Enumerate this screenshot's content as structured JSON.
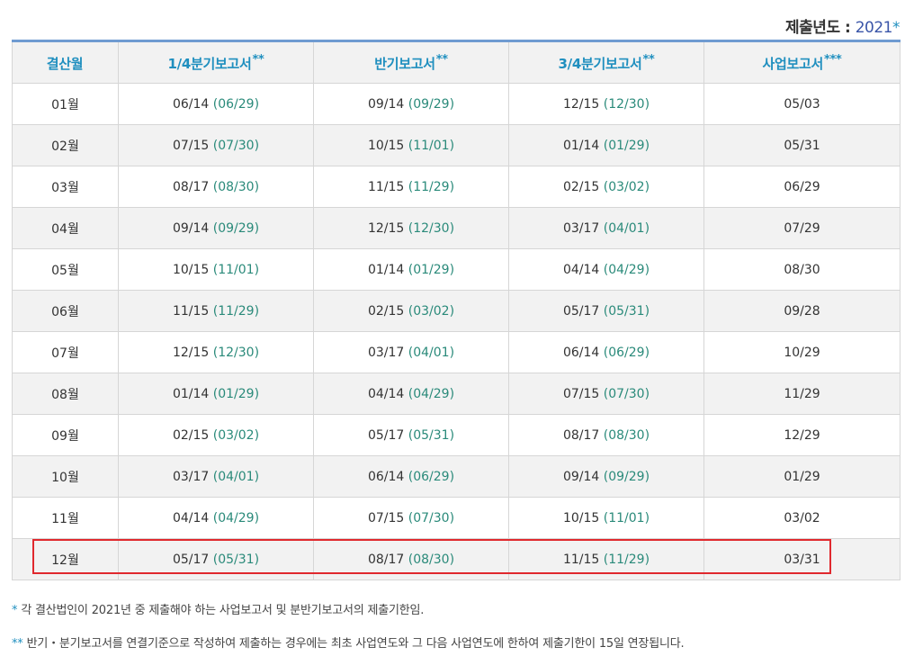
{
  "year_line": {
    "label": "제출년도 : ",
    "year": "2021",
    "star": "*"
  },
  "table": {
    "headers": [
      {
        "label": "결산월",
        "stars": ""
      },
      {
        "label": "1/4분기보고서",
        "stars": "**"
      },
      {
        "label": "반기보고서",
        "stars": "**"
      },
      {
        "label": "3/4분기보고서",
        "stars": "**"
      },
      {
        "label": "사업보고서",
        "stars": "***"
      }
    ],
    "rows": [
      {
        "month": "01월",
        "q1": "06/14",
        "q1_ext": "(06/29)",
        "half": "09/14",
        "half_ext": "(09/29)",
        "q3": "12/15",
        "q3_ext": "(12/30)",
        "annual": "05/03"
      },
      {
        "month": "02월",
        "q1": "07/15",
        "q1_ext": "(07/30)",
        "half": "10/15",
        "half_ext": "(11/01)",
        "q3": "01/14",
        "q3_ext": "(01/29)",
        "annual": "05/31"
      },
      {
        "month": "03월",
        "q1": "08/17",
        "q1_ext": "(08/30)",
        "half": "11/15",
        "half_ext": "(11/29)",
        "q3": "02/15",
        "q3_ext": "(03/02)",
        "annual": "06/29"
      },
      {
        "month": "04월",
        "q1": "09/14",
        "q1_ext": "(09/29)",
        "half": "12/15",
        "half_ext": "(12/30)",
        "q3": "03/17",
        "q3_ext": "(04/01)",
        "annual": "07/29"
      },
      {
        "month": "05월",
        "q1": "10/15",
        "q1_ext": "(11/01)",
        "half": "01/14",
        "half_ext": "(01/29)",
        "q3": "04/14",
        "q3_ext": "(04/29)",
        "annual": "08/30"
      },
      {
        "month": "06월",
        "q1": "11/15",
        "q1_ext": "(11/29)",
        "half": "02/15",
        "half_ext": "(03/02)",
        "q3": "05/17",
        "q3_ext": "(05/31)",
        "annual": "09/28"
      },
      {
        "month": "07월",
        "q1": "12/15",
        "q1_ext": "(12/30)",
        "half": "03/17",
        "half_ext": "(04/01)",
        "q3": "06/14",
        "q3_ext": "(06/29)",
        "annual": "10/29"
      },
      {
        "month": "08월",
        "q1": "01/14",
        "q1_ext": "(01/29)",
        "half": "04/14",
        "half_ext": "(04/29)",
        "q3": "07/15",
        "q3_ext": "(07/30)",
        "annual": "11/29"
      },
      {
        "month": "09월",
        "q1": "02/15",
        "q1_ext": "(03/02)",
        "half": "05/17",
        "half_ext": "(05/31)",
        "q3": "08/17",
        "q3_ext": "(08/30)",
        "annual": "12/29"
      },
      {
        "month": "10월",
        "q1": "03/17",
        "q1_ext": "(04/01)",
        "half": "06/14",
        "half_ext": "(06/29)",
        "q3": "09/14",
        "q3_ext": "(09/29)",
        "annual": "01/29"
      },
      {
        "month": "11월",
        "q1": "04/14",
        "q1_ext": "(04/29)",
        "half": "07/15",
        "half_ext": "(07/30)",
        "q3": "10/15",
        "q3_ext": "(11/01)",
        "annual": "03/02"
      },
      {
        "month": "12월",
        "q1": "05/17",
        "q1_ext": "(05/31)",
        "half": "08/17",
        "half_ext": "(08/30)",
        "q3": "11/15",
        "q3_ext": "(11/29)",
        "annual": "03/31"
      }
    ]
  },
  "notes": [
    {
      "mark": "*",
      "text": "각 결산법인이 2021년 중 제출해야 하는 사업보고서 및 분반기보고서의 제출기한임."
    },
    {
      "mark": "**",
      "text": "반기・분기보고서를 연결기준으로 작성하여 제출하는 경우에는 최초 사업연도와 그 다음 사업연도에 한하여 제출기한이 15일 연장됩니다."
    }
  ],
  "colors": {
    "header_text": "#1f8fbf",
    "extended_date": "#2a8a7a",
    "year_value": "#3a55a8",
    "highlight_border": "#e0292e",
    "table_top_border": "#6f9bd1"
  }
}
